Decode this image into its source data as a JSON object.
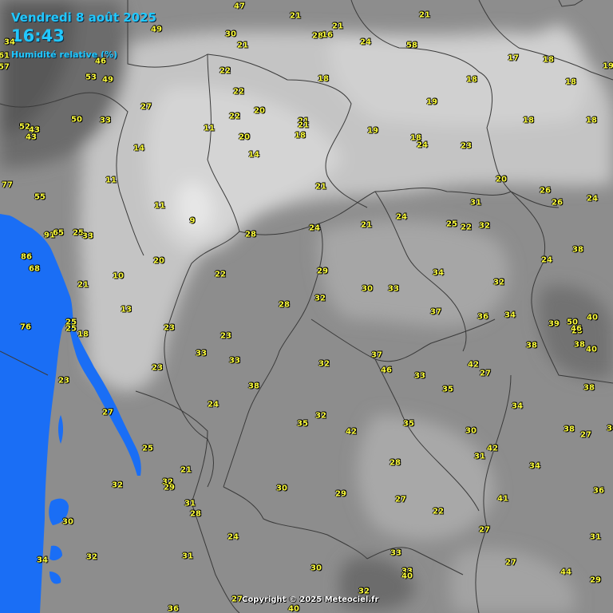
{
  "header": {
    "date": "Vendredi 8 août 2025",
    "time": "16:43",
    "parameter": "Humidité relative (%)"
  },
  "copyright": "Copyright © 2025 Meteociel.fr",
  "colors": {
    "sea": "#1a6ef5",
    "text_values": "#ffff3c",
    "header_text": "#22c8ff"
  },
  "stations": [
    "47",
    "21",
    "21",
    "49",
    "30",
    "28",
    "16",
    "21",
    "24",
    "58",
    "34",
    "21",
    "17",
    "18",
    "61",
    "57",
    "46",
    "53",
    "49",
    "22",
    "18",
    "18",
    "19",
    "22",
    "27",
    "20",
    "22",
    "21",
    "19",
    "18",
    "18",
    "52",
    "43",
    "50",
    "33",
    "11",
    "20",
    "18",
    "19",
    "24",
    "23",
    "43",
    "14",
    "18",
    "14",
    "21",
    "20",
    "18",
    "26",
    "26",
    "24",
    "11",
    "77",
    "55",
    "9",
    "31",
    "11",
    "21",
    "24",
    "25",
    "22",
    "32",
    "91",
    "65",
    "25",
    "33",
    "24",
    "21",
    "28",
    "86",
    "20",
    "68",
    "10",
    "22",
    "29",
    "24",
    "34",
    "32",
    "21",
    "30",
    "33",
    "38",
    "13",
    "28",
    "32",
    "36",
    "37",
    "34",
    "39",
    "50",
    "40",
    "76",
    "25",
    "25",
    "25",
    "18",
    "23",
    "23",
    "46",
    "38",
    "40",
    "33",
    "33",
    "37",
    "38",
    "23",
    "32",
    "46",
    "33",
    "42",
    "35",
    "27",
    "38",
    "34",
    "24",
    "38",
    "35",
    "23",
    "27",
    "35",
    "32",
    "42",
    "38",
    "30",
    "27",
    "25",
    "31",
    "42",
    "28",
    "21",
    "32",
    "29",
    "22",
    "32",
    "31",
    "34",
    "30",
    "29",
    "27",
    "28",
    "41",
    "36",
    "30",
    "24",
    "27",
    "31",
    "34",
    "32",
    "31",
    "33",
    "33",
    "40",
    "27",
    "30",
    "30",
    "44",
    "29",
    "32",
    "27",
    "40",
    "36"
  ]
}
